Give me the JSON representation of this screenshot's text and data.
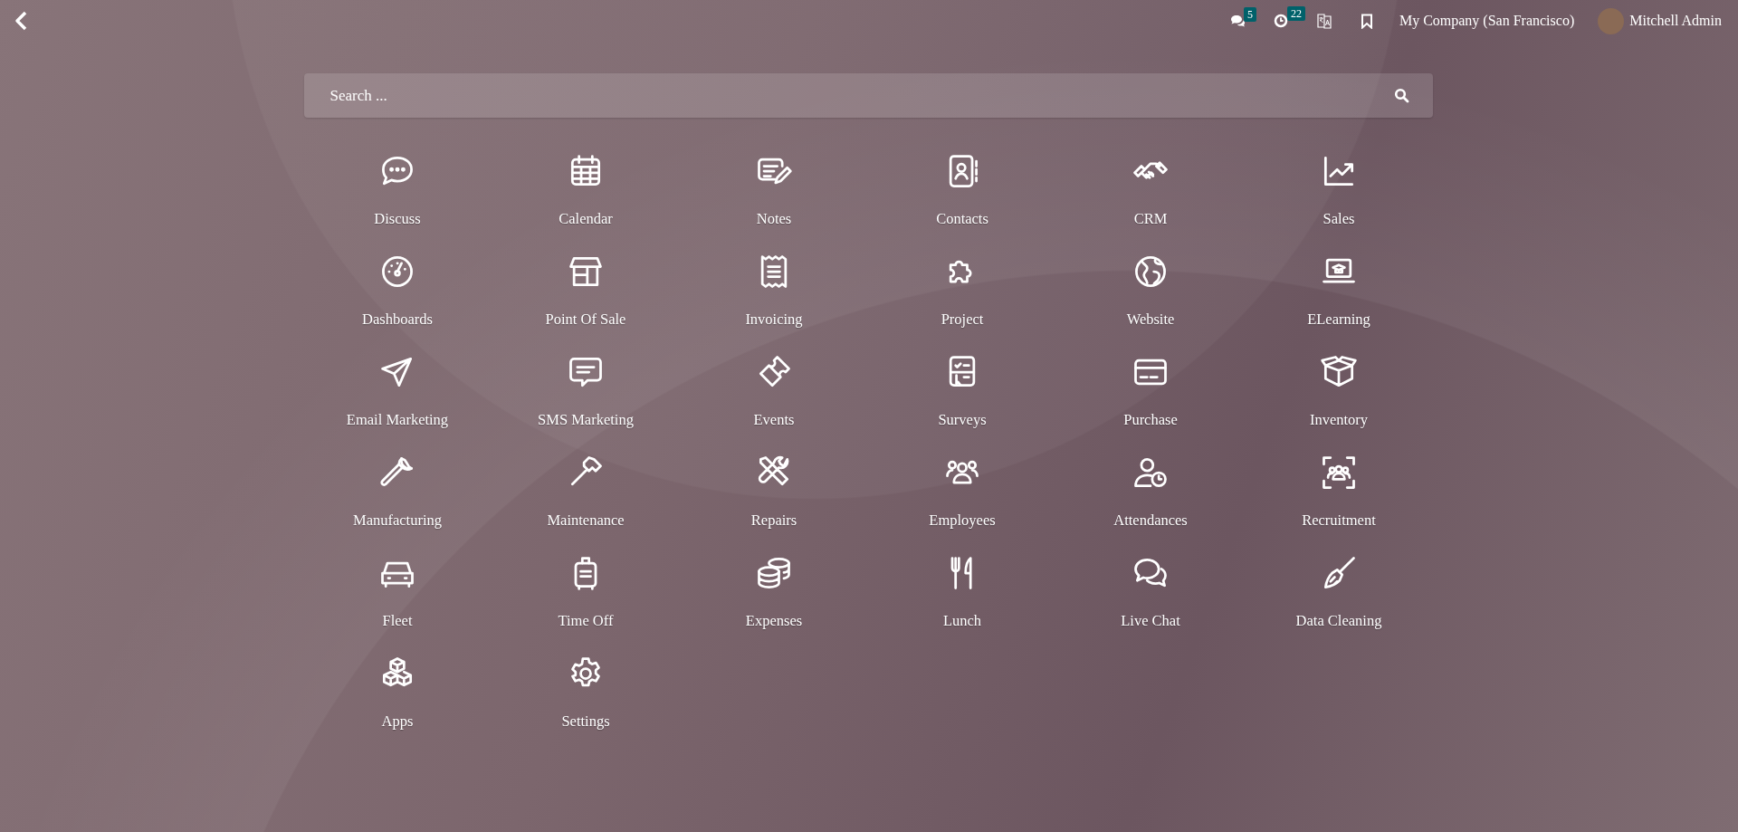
{
  "topbar": {
    "messages_count": "5",
    "activities_count": "22",
    "company": "My Company (San Francisco)",
    "user": "Mitchell Admin"
  },
  "search": {
    "placeholder": "Search ..."
  },
  "apps": [
    {
      "label": "Discuss"
    },
    {
      "label": "Calendar"
    },
    {
      "label": "Notes"
    },
    {
      "label": "Contacts"
    },
    {
      "label": "CRM"
    },
    {
      "label": "Sales"
    },
    {
      "label": "Dashboards"
    },
    {
      "label": "Point Of Sale"
    },
    {
      "label": "Invoicing"
    },
    {
      "label": "Project"
    },
    {
      "label": "Website"
    },
    {
      "label": "ELearning"
    },
    {
      "label": "Email Marketing"
    },
    {
      "label": "SMS Marketing"
    },
    {
      "label": "Events"
    },
    {
      "label": "Surveys"
    },
    {
      "label": "Purchase"
    },
    {
      "label": "Inventory"
    },
    {
      "label": "Manufacturing"
    },
    {
      "label": "Maintenance"
    },
    {
      "label": "Repairs"
    },
    {
      "label": "Employees"
    },
    {
      "label": "Attendances"
    },
    {
      "label": "Recruitment"
    },
    {
      "label": "Fleet"
    },
    {
      "label": "Time Off"
    },
    {
      "label": "Expenses"
    },
    {
      "label": "Lunch"
    },
    {
      "label": "Live Chat"
    },
    {
      "label": "Data Cleaning"
    },
    {
      "label": "Apps"
    },
    {
      "label": "Settings"
    }
  ]
}
